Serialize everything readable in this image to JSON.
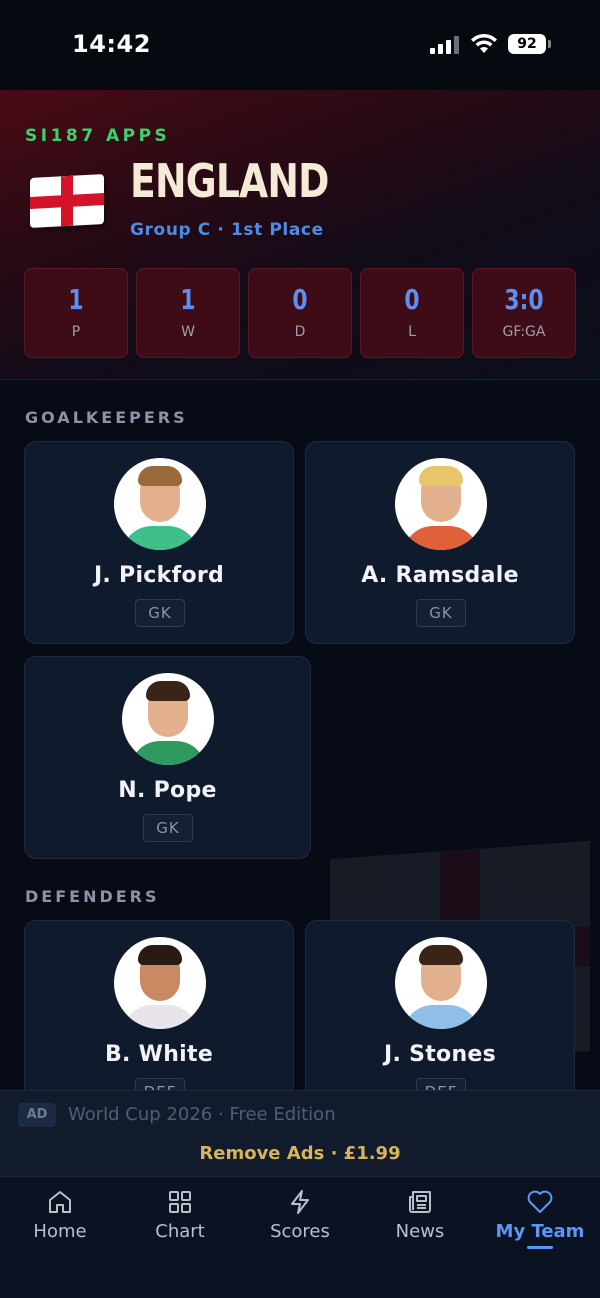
{
  "status_bar": {
    "time": "14:42",
    "battery": "92"
  },
  "header": {
    "brand": "SI187 APPS",
    "team_name": "ENGLAND",
    "subtitle": "Group C · 1st Place",
    "stats": [
      {
        "value": "1",
        "label": "P"
      },
      {
        "value": "1",
        "label": "W"
      },
      {
        "value": "0",
        "label": "D"
      },
      {
        "value": "0",
        "label": "L"
      },
      {
        "value": "3:0",
        "label": "GF:GA"
      }
    ]
  },
  "sections": {
    "goalkeepers": {
      "title": "GOALKEEPERS",
      "players": [
        {
          "name": "J. Pickford",
          "position": "GK"
        },
        {
          "name": "A. Ramsdale",
          "position": "GK"
        },
        {
          "name": "N. Pope",
          "position": "GK"
        }
      ]
    },
    "defenders": {
      "title": "DEFENDERS",
      "players": [
        {
          "name": "B. White",
          "position": "DEF"
        },
        {
          "name": "J. Stones",
          "position": "DEF"
        }
      ]
    }
  },
  "ad": {
    "badge": "AD",
    "text": "World Cup 2026 · Free Edition",
    "remove_label": "Remove Ads · £1.99"
  },
  "tabbar": {
    "tabs": [
      {
        "label": "Home",
        "icon": "home-icon"
      },
      {
        "label": "Chart",
        "icon": "grid-icon"
      },
      {
        "label": "Scores",
        "icon": "lightning-icon"
      },
      {
        "label": "News",
        "icon": "newspaper-icon"
      },
      {
        "label": "My Team",
        "icon": "heart-icon"
      }
    ],
    "active": "My Team"
  },
  "colors": {
    "accent": "#5d97f5",
    "brand": "#3ad26b",
    "header_red": "#3d0c16",
    "gold": "#d7b45b"
  }
}
